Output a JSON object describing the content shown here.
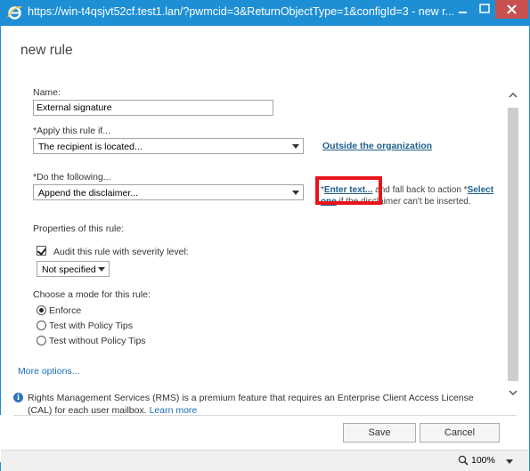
{
  "window": {
    "url_title": "https://win-t4qsjvt52cf.test1.lan/?pwmcid=3&ReturnObjectType=1&configId=3 - new r...",
    "minimize_glyph": "—",
    "maximize_glyph": "☐",
    "close_glyph": "✕"
  },
  "form": {
    "title": "new rule",
    "name_label": "Name:",
    "name_value": "External signature",
    "apply_label": "*Apply this rule if...",
    "apply_select": "The recipient is located...",
    "apply_link": "Outside the organization",
    "do_label": "*Do the following...",
    "do_select": "Append the disclaimer...",
    "disclaimer_prefix": "*",
    "disclaimer_enter_text": "Enter text...",
    "disclaimer_middle": " and fall back to action *",
    "disclaimer_select_text": "Select",
    "disclaimer_select_tail": "one",
    "disclaimer_suffix": " if the disclaimer can't be inserted.",
    "properties_label": "Properties of this rule:",
    "audit_label": "Audit this rule with severity level:",
    "audit_checked": true,
    "severity_value": "Not specified",
    "mode_label": "Choose a mode for this rule:",
    "modes": [
      "Enforce",
      "Test with Policy Tips",
      "Test without Policy Tips"
    ],
    "selected_mode": "Enforce",
    "more_options": "More options..."
  },
  "info": {
    "text": "Rights Management Services (RMS) is a premium feature that requires an Enterprise Client Access License (CAL) for each user mailbox.",
    "link": "Learn more"
  },
  "footer": {
    "save": "Save",
    "cancel": "Cancel"
  },
  "status": {
    "zoom": "100%"
  },
  "colors": {
    "titlebar": "#1e8fd5",
    "close_button": "#c75050",
    "highlight_box": "#e8131b",
    "link": "#1f5e8a"
  }
}
